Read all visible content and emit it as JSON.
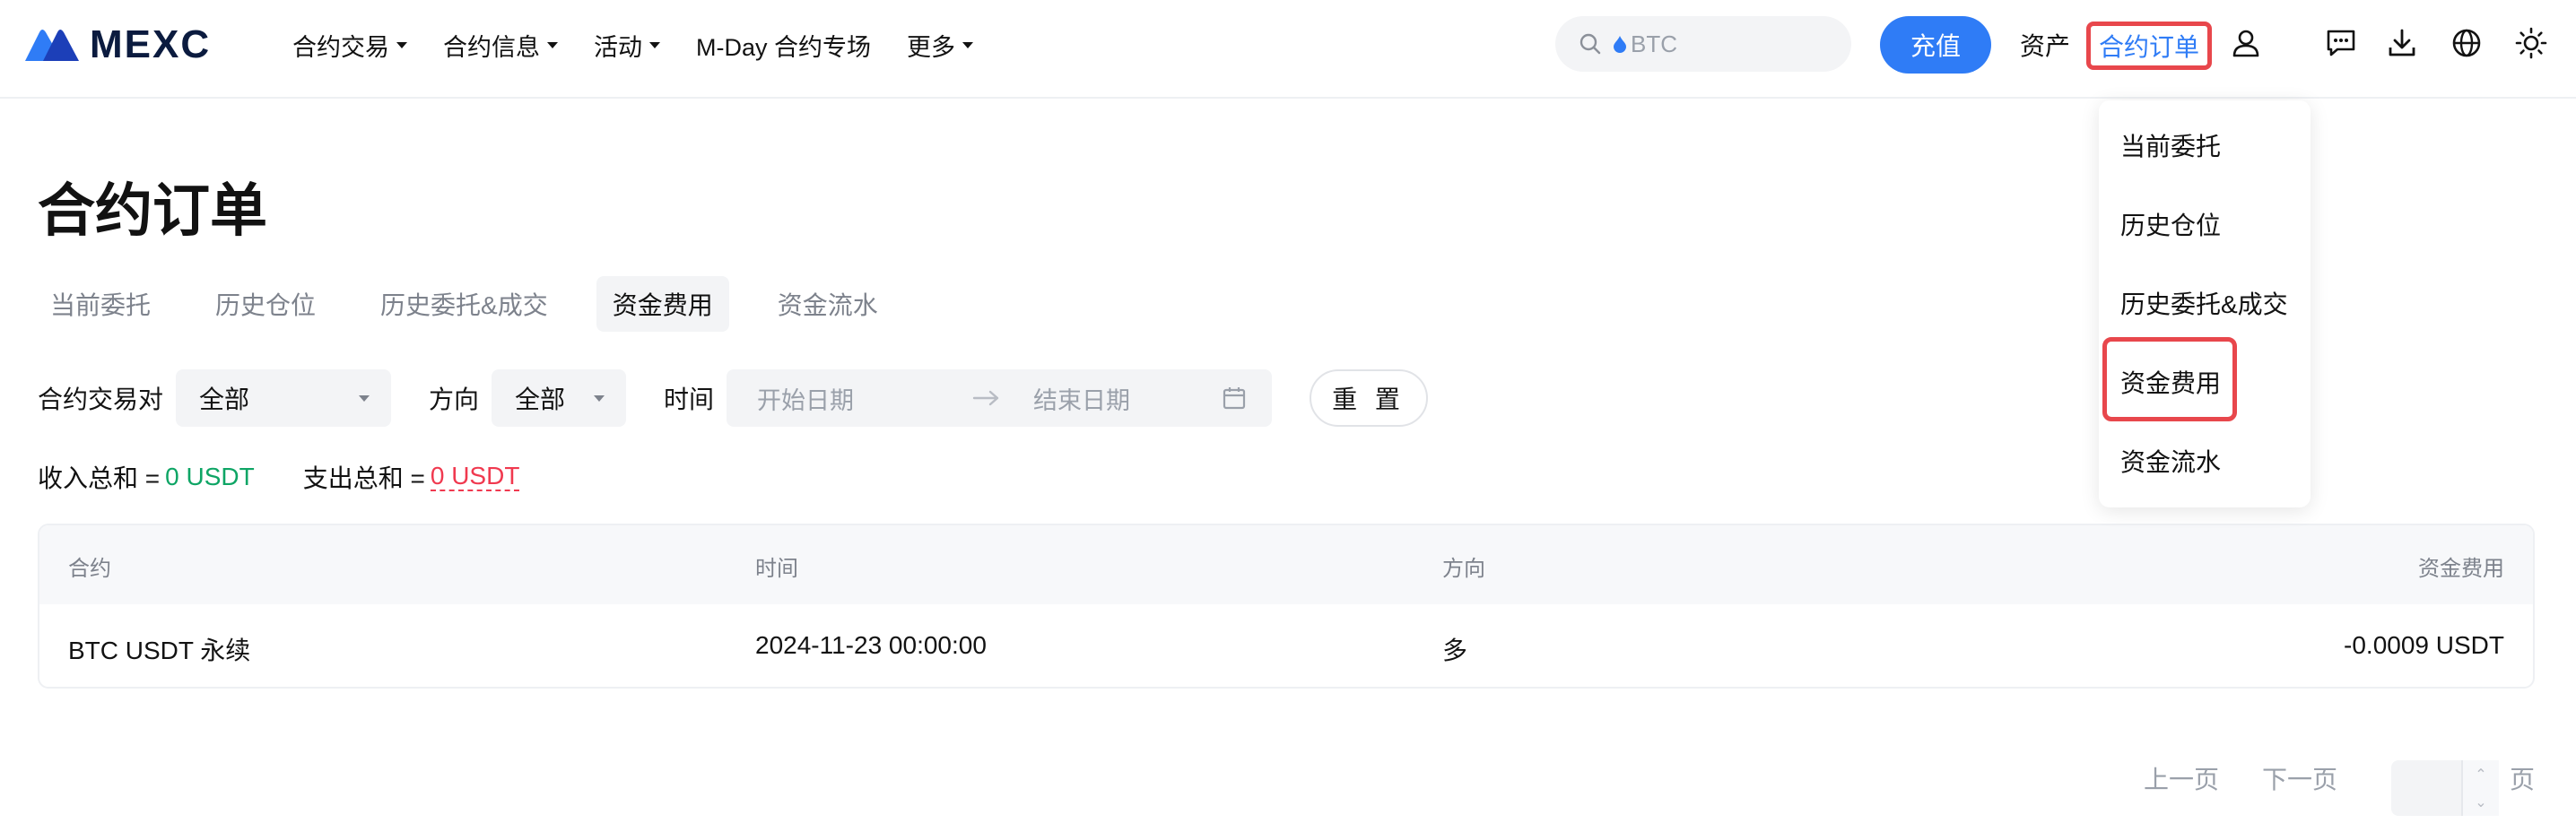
{
  "header": {
    "logo_text": "MEXC",
    "nav": [
      {
        "label": "合约交易",
        "has_caret": true
      },
      {
        "label": "合约信息",
        "has_caret": true
      },
      {
        "label": "活动",
        "has_caret": true
      },
      {
        "label": "M-Day 合约专场",
        "has_caret": false
      },
      {
        "label": "更多",
        "has_caret": true
      }
    ],
    "search_placeholder": "BTC",
    "deposit_label": "充值",
    "assets_label": "资产",
    "orders_label": "合约订单",
    "icons": [
      "user-icon",
      "message-icon",
      "download-icon",
      "globe-icon",
      "theme-icon"
    ]
  },
  "page": {
    "title": "合约订单",
    "tabs": [
      {
        "label": "当前委托",
        "active": false
      },
      {
        "label": "历史仓位",
        "active": false
      },
      {
        "label": "历史委托&成交",
        "active": false
      },
      {
        "label": "资金费用",
        "active": true
      },
      {
        "label": "资金流水",
        "active": false
      }
    ]
  },
  "filters": {
    "pair_label": "合约交易对",
    "pair_value": "全部",
    "direction_label": "方向",
    "direction_value": "全部",
    "time_label": "时间",
    "start_placeholder": "开始日期",
    "end_placeholder": "结束日期",
    "reset_label": "重 置"
  },
  "summary": {
    "income_label": "收入总和 =",
    "income_value": "0 USDT",
    "expense_label": "支出总和 =",
    "expense_value": "0 USDT"
  },
  "table": {
    "columns": [
      "合约",
      "时间",
      "方向",
      "资金费用"
    ],
    "rows": [
      {
        "contract": "BTC USDT 永续",
        "time": "2024-11-23 00:00:00",
        "direction": "多",
        "fee": "-0.0009 USDT"
      }
    ]
  },
  "pagination": {
    "prev_label": "上一页",
    "next_label": "下一页",
    "page_value": "",
    "page_suffix": "页"
  },
  "dropdown": {
    "items": [
      "当前委托",
      "历史仓位",
      "历史委托&成交",
      "资金费用",
      "资金流水"
    ],
    "highlighted": "资金费用"
  },
  "colors": {
    "accent": "#2f7cf6",
    "positive": "#0ea565",
    "negative": "#f0394f",
    "highlight_box": "#e8474c"
  }
}
